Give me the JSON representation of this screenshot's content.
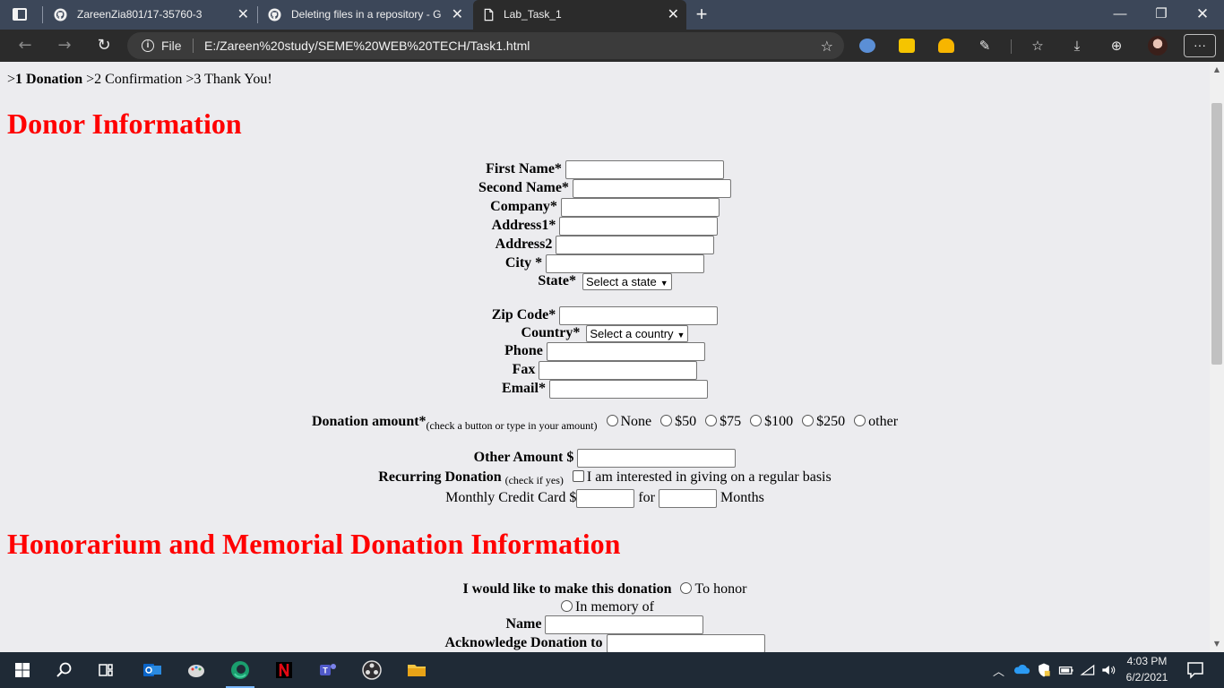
{
  "browser": {
    "tabs": [
      {
        "label": "ZareenZia801/17-35760-3",
        "icon": "github-icon"
      },
      {
        "label": "Deleting files in a repository - Gi",
        "icon": "github-icon"
      },
      {
        "label": "Lab_Task_1",
        "icon": "page-icon"
      }
    ],
    "close_glyph": "✕",
    "new_tab_glyph": "+",
    "window_controls": {
      "minimize": "—",
      "restore": "❐",
      "close": "✕"
    },
    "omnibox": {
      "scheme_label": "File",
      "url": "E:/Zareen%20study/SEME%20WEB%20TECH/Task1.html"
    },
    "more_label": "···"
  },
  "page": {
    "breadcrumb": {
      "step1_prefix": ">",
      "step1": "1 Donation",
      "step2": ">2 Confirmation",
      "step3": ">3 Thank You!"
    },
    "donor_heading": "Donor Information",
    "fields": {
      "first_name": "First Name*",
      "second_name": "Second Name*",
      "company": "Company*",
      "address1": "Address1*",
      "address2": "Address2",
      "city": "City *",
      "state": "State*",
      "state_select": "Select a state",
      "zip": "Zip Code*",
      "country": "Country*",
      "country_select": "Select a country",
      "phone": "Phone",
      "fax": "Fax",
      "email": "Email*"
    },
    "donation": {
      "label": "Donation amount*",
      "hint": "(check a button or type in your amount)",
      "options": [
        "None",
        "$50",
        "$75",
        "$100",
        "$250",
        "other"
      ],
      "other_amount_label": "Other Amount $",
      "recurring_label": "Recurring Donation",
      "recurring_hint": "(check if yes)",
      "recurring_text": "I am interested in giving on a regular basis",
      "monthly_label": "Monthly Credit Card $",
      "for_label": "for",
      "months_label": "Months"
    },
    "honor_heading": "Honorarium and Memorial Donation Information",
    "honor": {
      "make_label": "I would like to make this donation",
      "to_honor": "To honor",
      "in_memory": "In memory of",
      "name_label": "Name",
      "acknowledge_label": "Acknowledge Donation to"
    }
  },
  "taskbar": {
    "time": "4:03 PM",
    "date": "6/2/2021"
  }
}
